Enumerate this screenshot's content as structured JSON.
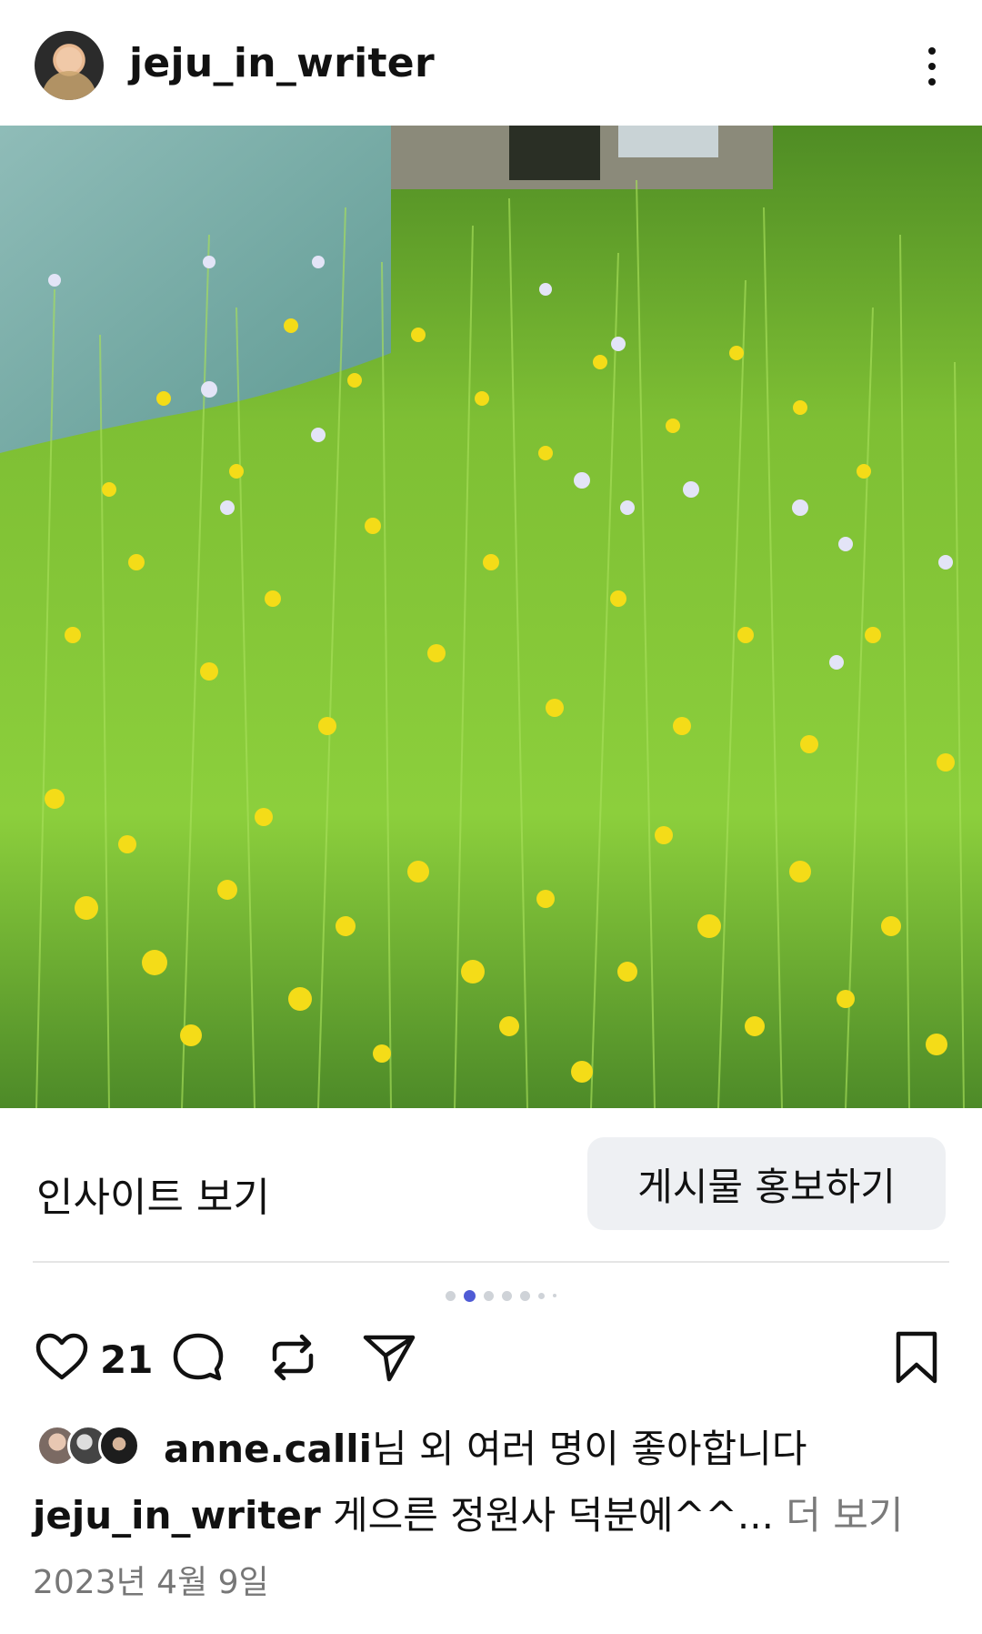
{
  "header": {
    "username": "jeju_in_writer",
    "avatar_icon": "profile-avatar",
    "more_icon": "more-vertical-icon"
  },
  "post": {
    "image_description_icon": "photo",
    "insight_label": "인사이트 보기",
    "promote_label": "게시물 홍보하기",
    "carousel": {
      "total": 7,
      "active_index": 1
    }
  },
  "actions": {
    "like_icon": "heart-icon",
    "likes": "21",
    "comment_icon": "comment-icon",
    "repost_icon": "repost-icon",
    "share_icon": "send-icon",
    "save_icon": "bookmark-icon"
  },
  "liked_by": {
    "name": "anne.calli",
    "suffix": "님 외 여러 명이 좋아합니다"
  },
  "caption": {
    "author": "jeju_in_writer",
    "text": " 게으른 정원사 덕분에^^...",
    "more": " 더 보기"
  },
  "date": "2023년 4월 9일",
  "colors": {
    "accent_dot": "#4f5bd5",
    "promote_bg": "#eef0f3",
    "muted_text": "#777777"
  }
}
